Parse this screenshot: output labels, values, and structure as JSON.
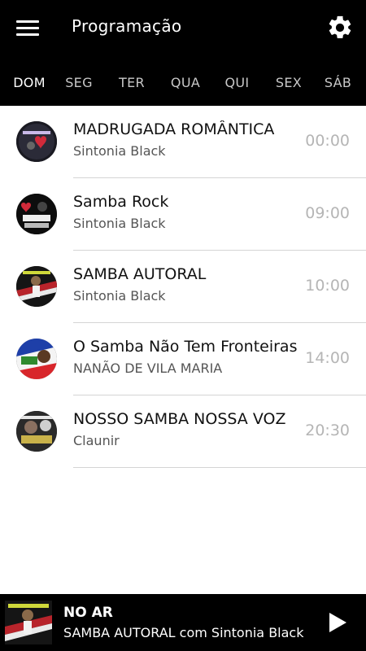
{
  "header": {
    "title": "Programação",
    "menu_icon": "hamburger-menu-icon",
    "settings_icon": "gear-icon",
    "background": "#000000"
  },
  "tabs": [
    {
      "label": "DOM",
      "active": true
    },
    {
      "label": "SEG",
      "active": false
    },
    {
      "label": "TER",
      "active": false
    },
    {
      "label": "QUA",
      "active": false
    },
    {
      "label": "QUI",
      "active": false
    },
    {
      "label": "SEX",
      "active": false
    },
    {
      "label": "SÁB",
      "active": false
    }
  ],
  "schedule": [
    {
      "title": "MADRUGADA ROMÂNTICA",
      "host": "Sintonia Black",
      "time": "00:00"
    },
    {
      "title": "Samba Rock",
      "host": "Sintonia Black",
      "time": "09:00"
    },
    {
      "title": "SAMBA AUTORAL",
      "host": "Sintonia Black",
      "time": "10:00"
    },
    {
      "title": "O Samba Não Tem Fronteiras",
      "host": "NANÃO DE VILA MARIA",
      "time": "14:00"
    },
    {
      "title": "NOSSO SAMBA NOSSA VOZ",
      "host": "Claunir",
      "time": "20:30"
    }
  ],
  "player": {
    "label": "NO AR",
    "track": "SAMBA AUTORAL com Sintonia Black",
    "play_icon": "play-icon"
  },
  "colors": {
    "header_bg": "#000000",
    "tab_active": "#ffffff",
    "tab_inactive": "#c8c8c8",
    "time_text": "#b5b5b5",
    "divider": "#d4d4d4"
  }
}
